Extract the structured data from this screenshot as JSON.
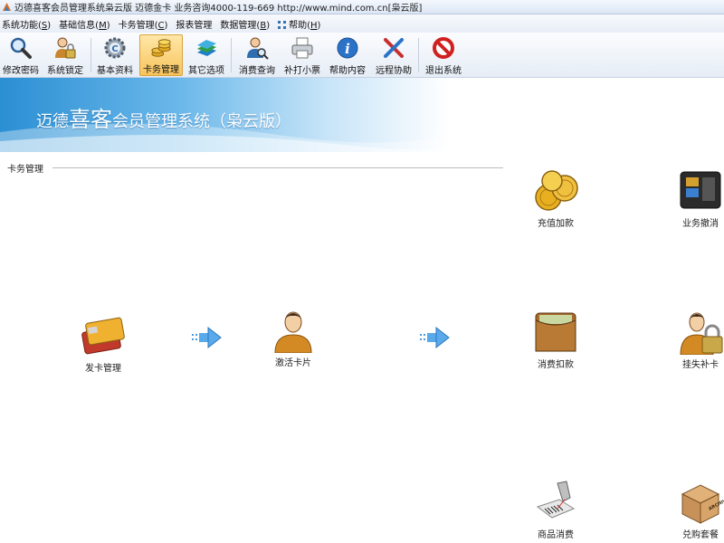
{
  "window": {
    "title": "迈德喜客会员管理系统枭云版  迈德金卡  业务咨询4000-119-669  http://www.mind.com.cn[枭云版]"
  },
  "menu": {
    "items": [
      {
        "label": "系统功能(",
        "key": "S",
        "suffix": ")"
      },
      {
        "label": "基础信息(",
        "key": "M",
        "suffix": ")"
      },
      {
        "label": "卡务管理(",
        "key": "C",
        "suffix": ")"
      },
      {
        "label": "报表管理",
        "key": "",
        "suffix": ""
      },
      {
        "label": "数据管理(",
        "key": "B",
        "suffix": ")"
      },
      {
        "label": "帮助(",
        "key": "H",
        "suffix": ")"
      }
    ]
  },
  "toolbar": {
    "buttons": [
      {
        "label": "修改密码",
        "icon": "magnifier-icon"
      },
      {
        "label": "系统锁定",
        "icon": "user-lock-icon"
      },
      {
        "label": "基本资料",
        "icon": "gear-icon"
      },
      {
        "label": "卡务管理",
        "icon": "coins-icon",
        "active": true
      },
      {
        "label": "其它选项",
        "icon": "books-icon"
      },
      {
        "label": "消费查询",
        "icon": "user-search-icon"
      },
      {
        "label": "补打小票",
        "icon": "printer-icon"
      },
      {
        "label": "帮助内容",
        "icon": "info-icon"
      },
      {
        "label": "远程协助",
        "icon": "tools-icon"
      },
      {
        "label": "退出系统",
        "icon": "stop-icon"
      }
    ]
  },
  "banner": {
    "prefix": "迈德",
    "highlight": "喜客",
    "suffix": "会员管理系统（枭云版）"
  },
  "section": {
    "title": "卡务管理"
  },
  "functions": {
    "issue_card": "发卡管理",
    "activate_card": "激活卡片",
    "recharge": "充值加款",
    "cancel": "业务撤消",
    "consume_deduct": "消费扣款",
    "report_loss": "挂失补卡",
    "goods_consume": "商品消费",
    "package_redeem": "兑购套餐"
  },
  "colors": {
    "accent": "#f8c45c",
    "banner": "#2b8fd3"
  }
}
